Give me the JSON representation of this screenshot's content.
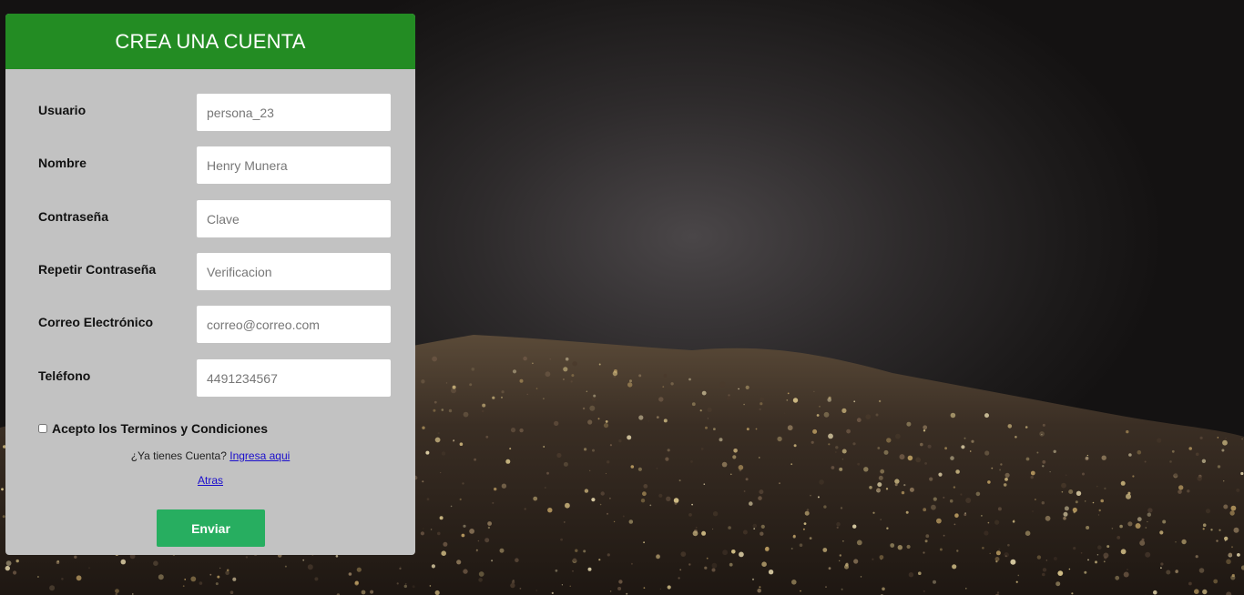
{
  "header": {
    "title": "CREA UNA CUENTA"
  },
  "form": {
    "fields": [
      {
        "label": "Usuario",
        "placeholder": "persona_23"
      },
      {
        "label": "Nombre",
        "placeholder": "Henry Munera"
      },
      {
        "label": "Contraseña",
        "placeholder": "Clave"
      },
      {
        "label": "Repetir Contraseña",
        "placeholder": "Verificacion"
      },
      {
        "label": "Correo Electrónico",
        "placeholder": "correo@correo.com"
      },
      {
        "label": "Teléfono",
        "placeholder": "4491234567"
      }
    ],
    "terms_label": "Acepto los Terminos y Condiciones",
    "terms_checked": false,
    "account_question": "¿Ya tienes Cuenta?",
    "login_link": "Ingresa aqui",
    "back_link": "Atras",
    "submit_label": "Enviar"
  },
  "colors": {
    "header_bg": "#238c23",
    "panel_bg": "#c2c2c2",
    "submit_bg": "#27ae60",
    "link": "#1a0dcc"
  }
}
